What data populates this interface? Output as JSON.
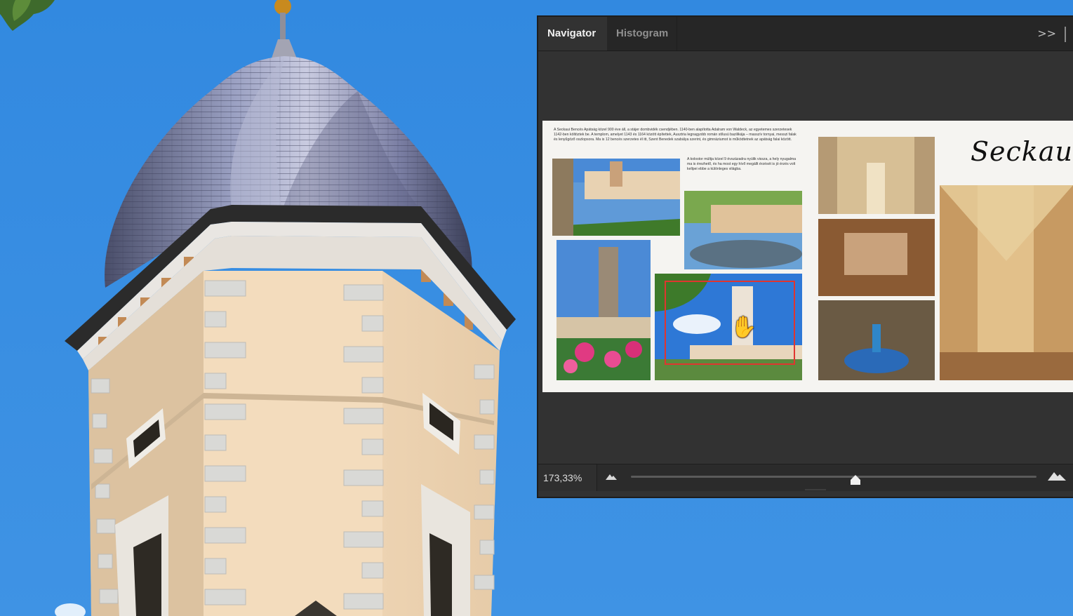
{
  "panel": {
    "tabs": [
      {
        "label": "Navigator",
        "active": true
      },
      {
        "label": "Histogram",
        "active": false
      }
    ],
    "menu_glyph": ">>"
  },
  "preview": {
    "title_script": "Seckau",
    "body_text": "A Seckaui Bencés Apátság közel 900 éve áll, a stájer dombvidék csendjében. 1140-ben alapította Adalram von Waldeck, az egyetemes szerzetesek 1142-ben költöztek be. A templom, amelyet 1143 és 1164 között építettek, Ausztria legnagyobb román stílusú bazilikája – masszív tornyai, messzi falak és lenyűgöző oszlopsora. Ma is 12 bencés szerzetes él itt, Szent Benedek szabálya szerint, és gimnáziumot is működtetnek az apátság falai között.",
    "body_text_2": "A kolostor múltja közel 9 évszázadra nyúlik vissza, a hely nyugalma ma is érezhető, és ha most egy hívő megállt érzését is jó érzés volt kellpei ebbe a különleges világba."
  },
  "zoom": {
    "value_text": "173,33%",
    "slider_fraction": 0.553
  },
  "colors": {
    "panel_bg": "#323232",
    "tabbar_bg": "#262626",
    "view_box": "#e0352f",
    "sky": "#3a8ee2"
  },
  "icons": {
    "zoom_out": "small-mountain-icon",
    "zoom_in": "large-mountain-icon",
    "hand": "hand-cursor-icon"
  }
}
